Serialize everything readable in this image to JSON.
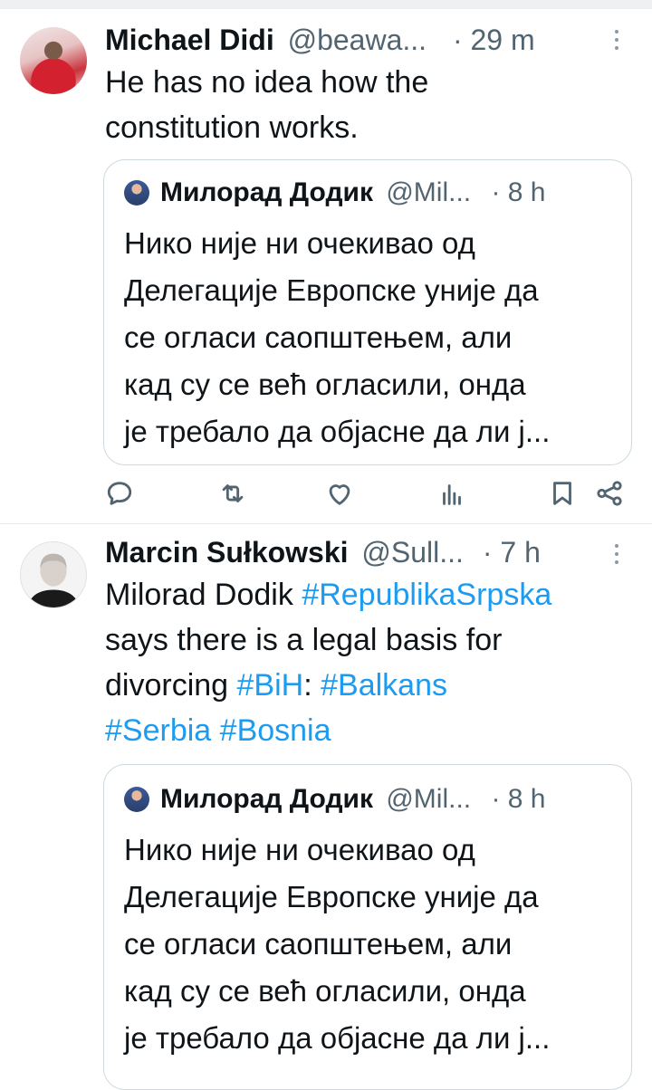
{
  "tweets": [
    {
      "author_name": "Michael Didi",
      "handle": "@beawa...",
      "time": "· 29 m",
      "text_lines": [
        "He has no idea how the",
        "constitution works."
      ],
      "quote": {
        "author_name": "Милорад Додик",
        "handle": "@Mil...",
        "time": "· 8 h",
        "text_lines": [
          "Нико није ни очекивао од",
          "Делегације Европске уније да",
          "се огласи саопштењем, али",
          "кад су се већ огласили, онда",
          "је требало да објасне да ли ј..."
        ]
      }
    },
    {
      "author_name": "Marcin Sułkowski",
      "handle": "@Sull...",
      "time": "· 7 h",
      "line1_text": "Milorad Dodik ",
      "line1_tag": "#RepublikaSrpska",
      "line2_text": "says there is a legal basis for",
      "line3_text": "divorcing ",
      "line3_tag1": "#BiH",
      "line3_mid": ": ",
      "line3_tag2": "#Balkans",
      "line4_tag1": "#Serbia",
      "line4_space": " ",
      "line4_tag2": "#Bosnia",
      "quote": {
        "author_name": "Милорад Додик",
        "handle": "@Mil...",
        "time": "· 8 h",
        "text_lines": [
          "Нико није ни очекивао од",
          "Делегације Европске уније да",
          "се огласи саопштењем, али",
          "кад су се већ огласили, онда",
          "је требало да објасне да ли ј..."
        ]
      }
    }
  ],
  "actions": [
    "reply-icon",
    "retweet-icon",
    "like-icon",
    "views-icon",
    "bookmark-icon",
    "share-icon"
  ],
  "colors": {
    "hashtag": "#1d9bf0",
    "secondary": "#536471",
    "border": "#cfd9de"
  }
}
